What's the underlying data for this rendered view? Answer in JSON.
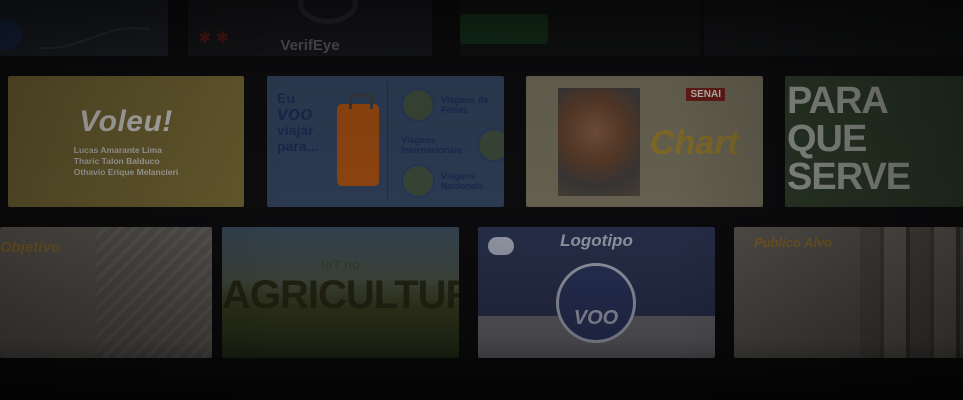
{
  "top_row": {
    "verifeye_label": "VerifEye"
  },
  "row1": {
    "voleu": {
      "title": "Voleu!",
      "names": [
        "Lucas Amarante Lima",
        "Tharic Talon Balduco",
        "Othavio Erique Melancieri"
      ]
    },
    "travel": {
      "line1": "Eu",
      "line2": "voo",
      "line3": "viajar",
      "line4": "para...",
      "items": [
        "Viagens de Férias",
        "Viagens Internacionais",
        "Viagens Nacionais"
      ]
    },
    "chart": {
      "brand_tag": "SENAI",
      "logo": "Chart"
    },
    "paraque": {
      "big": [
        "PARA",
        "QUE",
        "SERVE"
      ]
    }
  },
  "row2": {
    "objetivo": {
      "title": "Objetivo"
    },
    "agricultura": {
      "iot": "IoT no",
      "word": "AGRICULTURA"
    },
    "logotipo": {
      "title": "Logotipo",
      "emblem_text": "VOO"
    },
    "publico": {
      "title": "Publico Alvo"
    }
  },
  "colors": {
    "background": "#0d0d0f",
    "accent_gold": "#8c6a2a",
    "accent_navy": "#2b3452"
  }
}
